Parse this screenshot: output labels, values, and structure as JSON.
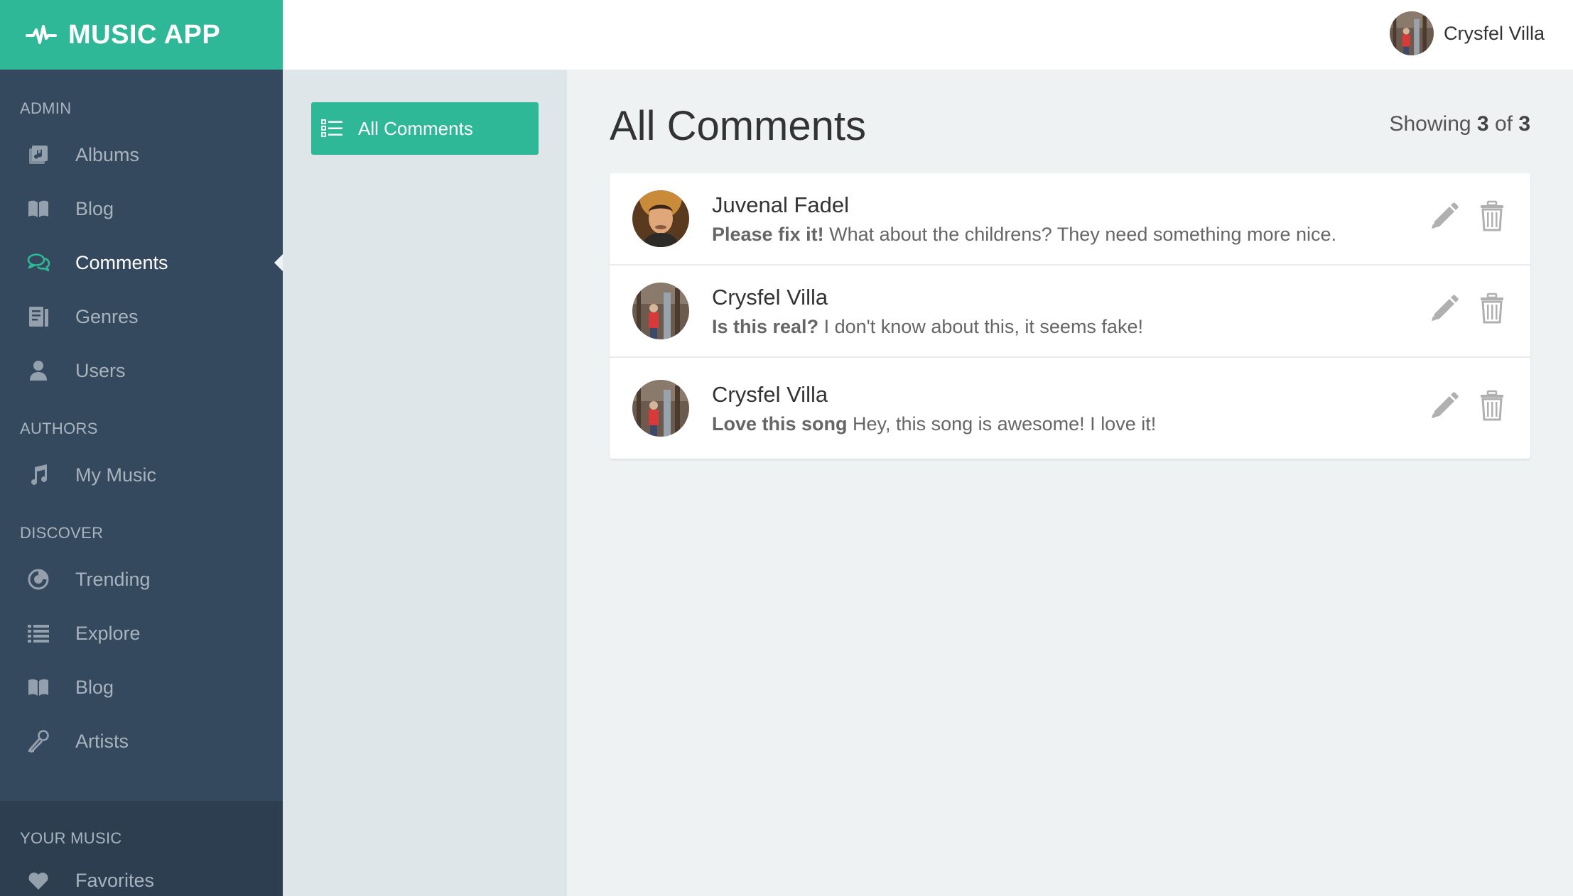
{
  "app": {
    "name": "MUSIC APP",
    "brand_color": "#2eb897",
    "sidebar_color": "#34495e",
    "logo_icon": "pulse-icon"
  },
  "sidebar": {
    "sections": [
      {
        "title": "ADMIN",
        "items": [
          {
            "label": "Albums",
            "icon": "album-icon"
          },
          {
            "label": "Blog",
            "icon": "book-icon"
          },
          {
            "label": "Comments",
            "icon": "comments-icon",
            "active": true
          },
          {
            "label": "Genres",
            "icon": "genres-icon"
          },
          {
            "label": "Users",
            "icon": "user-icon"
          }
        ]
      },
      {
        "title": "AUTHORS",
        "items": [
          {
            "label": "My Music",
            "icon": "music-note-icon"
          }
        ]
      },
      {
        "title": "DISCOVER",
        "items": [
          {
            "label": "Trending",
            "icon": "trending-icon"
          },
          {
            "label": "Explore",
            "icon": "list-icon"
          },
          {
            "label": "Blog",
            "icon": "book-icon"
          },
          {
            "label": "Artists",
            "icon": "microphone-icon"
          }
        ]
      },
      {
        "title": "YOUR MUSIC",
        "items": [
          {
            "label": "Favorites",
            "icon": "heart-icon"
          }
        ]
      }
    ]
  },
  "topbar": {
    "user_name": "Crysfel Villa"
  },
  "subnav": {
    "button_label": "All Comments",
    "button_icon": "list-icon"
  },
  "main": {
    "title": "All Comments",
    "showing_prefix": "Showing",
    "showing_count": "3",
    "showing_of": "of",
    "showing_total": "3",
    "comments": [
      {
        "author": "Juvenal Fadel",
        "subject": "Please fix it!",
        "text": "What about the childrens? They need something more nice."
      },
      {
        "author": "Crysfel Villa",
        "subject": "Is this real?",
        "text": "I don't know about this, it seems fake!"
      },
      {
        "author": "Crysfel Villa",
        "subject": "Love this song",
        "text": "Hey, this song is awesome! I love it!"
      }
    ],
    "edit_icon": "pencil-icon",
    "delete_icon": "trash-icon"
  }
}
